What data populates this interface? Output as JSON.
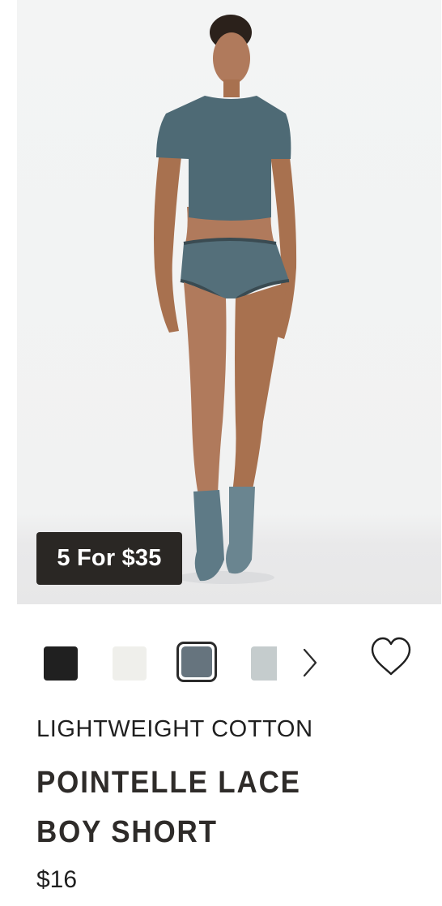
{
  "product": {
    "image_alt": "Model wearing teal lightweight cotton pointelle lace boy short with matching tee and socks",
    "promo_badge": "5 For $35",
    "collection": "LIGHTWEIGHT COTTON",
    "title": "POINTELLE LACE BOY SHORT",
    "price": "$16"
  },
  "swatches": {
    "colors": [
      "#202020",
      "#efefeb",
      "#66747e",
      "#c5cccd"
    ],
    "selected_index": 2
  },
  "icons": {
    "next": "chevron-right-icon",
    "wishlist": "heart-outline-icon"
  }
}
